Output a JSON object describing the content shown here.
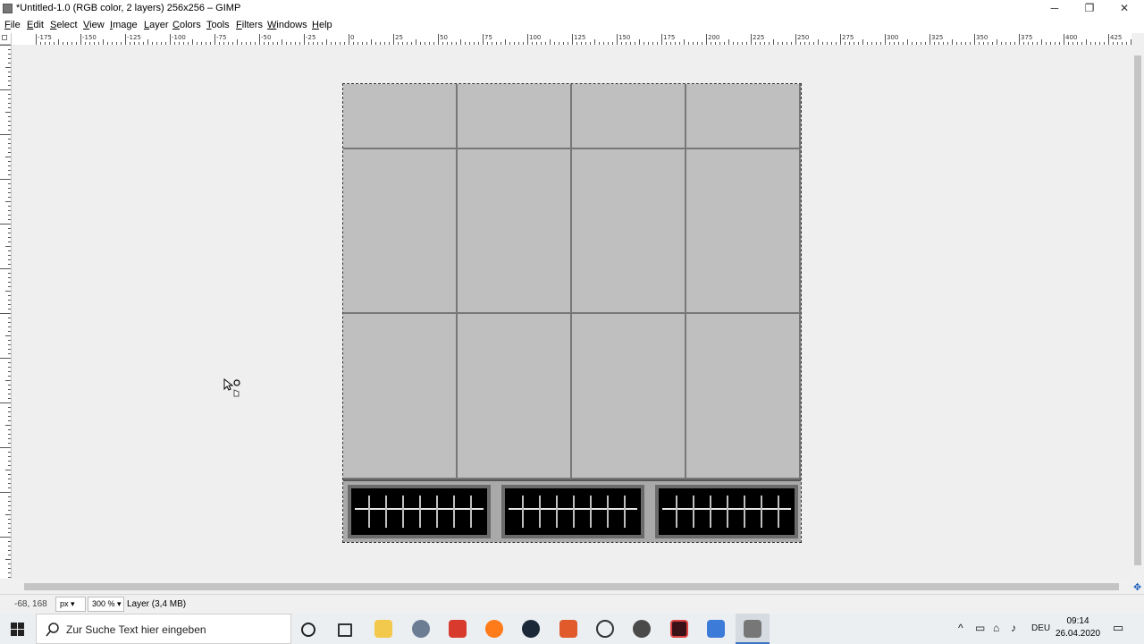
{
  "window": {
    "title": "*Untitled-1.0 (RGB color, 2 layers) 256x256 – GIMP",
    "minimize": "─",
    "maximize": "❐",
    "close": "✕"
  },
  "menu": [
    "File",
    "Edit",
    "Select",
    "View",
    "Image",
    "Layer",
    "Colors",
    "Tools",
    "Filters",
    "Windows",
    "Help"
  ],
  "ruler": {
    "h_labels": [
      "-175",
      "-150",
      "-125",
      "-100",
      "-75",
      "-50",
      "-25",
      "0",
      "25",
      "50",
      "75",
      "100",
      "125",
      "150",
      "175",
      "200",
      "225",
      "250",
      "275",
      "300",
      "325",
      "350",
      "375",
      "400",
      "425"
    ]
  },
  "status": {
    "coords": "-68, 168",
    "unit": "px",
    "zoom": "300 %",
    "layer": "Layer (3,4 MB)"
  },
  "taskbar": {
    "search_placeholder": "Zur Suche Text hier eingeben",
    "language": "DEU",
    "time": "09:14",
    "date": "26.04.2020"
  },
  "icons": {
    "app": "gimp-icon",
    "start": "windows-start-icon",
    "search": "search-icon",
    "cortana": "cortana-icon",
    "taskview": "task-view-icon"
  },
  "colors": {
    "canvas_bg": "#efefef",
    "image_tile": "#bfbfbf",
    "grout": "#777777",
    "grate": "#000000"
  }
}
